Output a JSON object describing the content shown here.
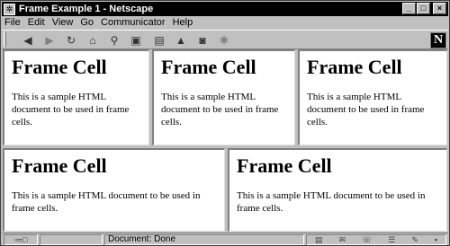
{
  "window": {
    "title": "Frame Example 1 - Netscape",
    "buttons": {
      "minimize": "_",
      "maximize": "□",
      "close": "×"
    }
  },
  "menu": [
    "File",
    "Edit",
    "View",
    "Go",
    "Communicator",
    "Help"
  ],
  "toolbar": {
    "icons": [
      "back-icon",
      "forward-icon",
      "reload-icon",
      "home-icon",
      "search-icon",
      "netscape-guide-icon",
      "print-icon",
      "security-icon",
      "shop-icon",
      "stop-icon"
    ],
    "logo": "N"
  },
  "frames": [
    {
      "heading": "Frame Cell",
      "body": "This is a sample HTML document to be used in frame cells."
    },
    {
      "heading": "Frame Cell",
      "body": "This is a sample HTML document to be used in frame cells."
    },
    {
      "heading": "Frame Cell",
      "body": "This is a sample HTML document to be used in frame cells."
    },
    {
      "heading": "Frame Cell",
      "body": "This is a sample HTML document to be used in frame cells."
    },
    {
      "heading": "Frame Cell",
      "body": "This is a sample HTML document to be used in frame cells."
    }
  ],
  "status": {
    "text": "Document: Done"
  }
}
